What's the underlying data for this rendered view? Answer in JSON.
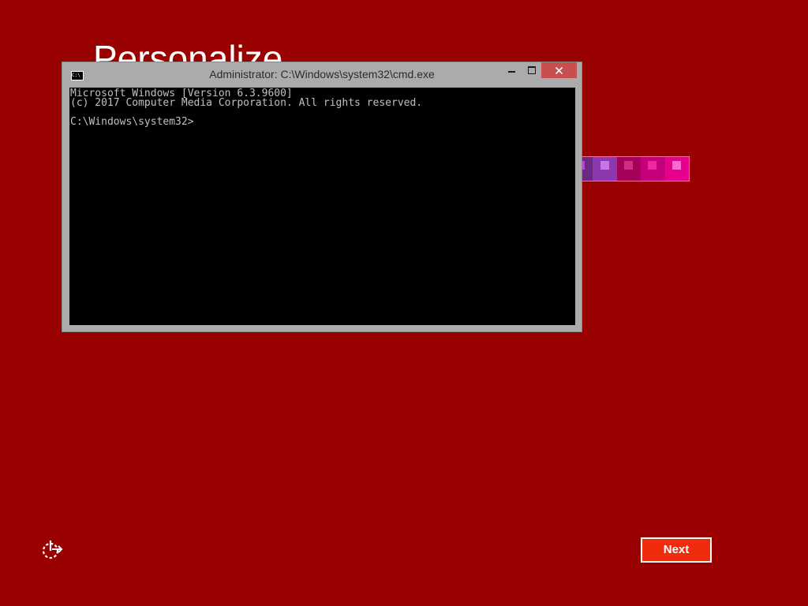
{
  "page": {
    "title": "Personalize",
    "background_color": "#990000"
  },
  "color_swatches": [
    {
      "color": "#6a2880",
      "accent": "#b54bd0"
    },
    {
      "color": "#8e38b0",
      "accent": "#c678e2"
    },
    {
      "color": "#a5005a",
      "accent": "#cf2d82"
    },
    {
      "color": "#c6007a",
      "accent": "#f0279e"
    },
    {
      "color": "#e6008c",
      "accent": "#ff6ad0"
    }
  ],
  "cmd_window": {
    "title": "Administrator: C:\\Windows\\system32\\cmd.exe",
    "icon_text": "C:\\",
    "close_glyph": "✕",
    "console_lines": [
      "Microsoft Windows [Version 6.3.9600]",
      "(c) 2017 Computer Media Corporation. All rights reserved.",
      "",
      "C:\\Windows\\system32>"
    ],
    "titlebar_color": "#ababab",
    "close_color": "#c7504f"
  },
  "footer": {
    "settings_icon": "ease-of-access-icon",
    "next_label": "Next",
    "next_color": "#ef2d0e"
  }
}
